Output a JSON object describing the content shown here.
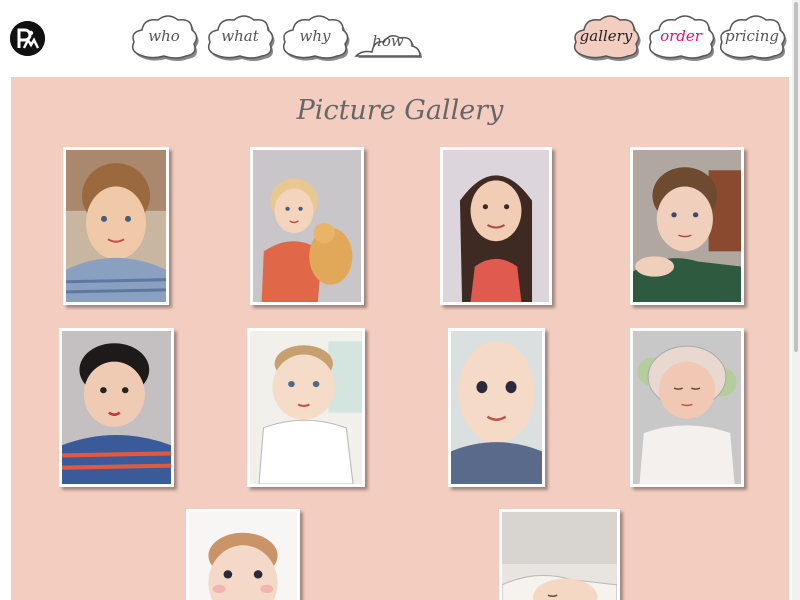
{
  "logo": {
    "icon": "pm-logo"
  },
  "nav": {
    "who": "who",
    "what": "what",
    "why": "why",
    "how": "how",
    "gallery": "gallery",
    "order": "order",
    "pricing": "pricing"
  },
  "colors": {
    "panel_bg": "#f4cdc1",
    "active_cloud": "#f4cdc1",
    "order_text": "#e0127a",
    "nav_text": "#555555"
  },
  "gallery": {
    "title": "Picture Gallery",
    "paintings": [
      {
        "subject": "boy with curly hair"
      },
      {
        "subject": "girl with teddy bear"
      },
      {
        "subject": "girl with long dark hair"
      },
      {
        "subject": "boy resting chin on hand"
      },
      {
        "subject": "boy in striped shirt"
      },
      {
        "subject": "baby in white sweater"
      },
      {
        "subject": "baby face close-up"
      },
      {
        "subject": "sleeping baby in bonnet"
      },
      {
        "subject": "baby with rosy cheeks"
      },
      {
        "subject": "sleeping baby in crib"
      }
    ]
  }
}
